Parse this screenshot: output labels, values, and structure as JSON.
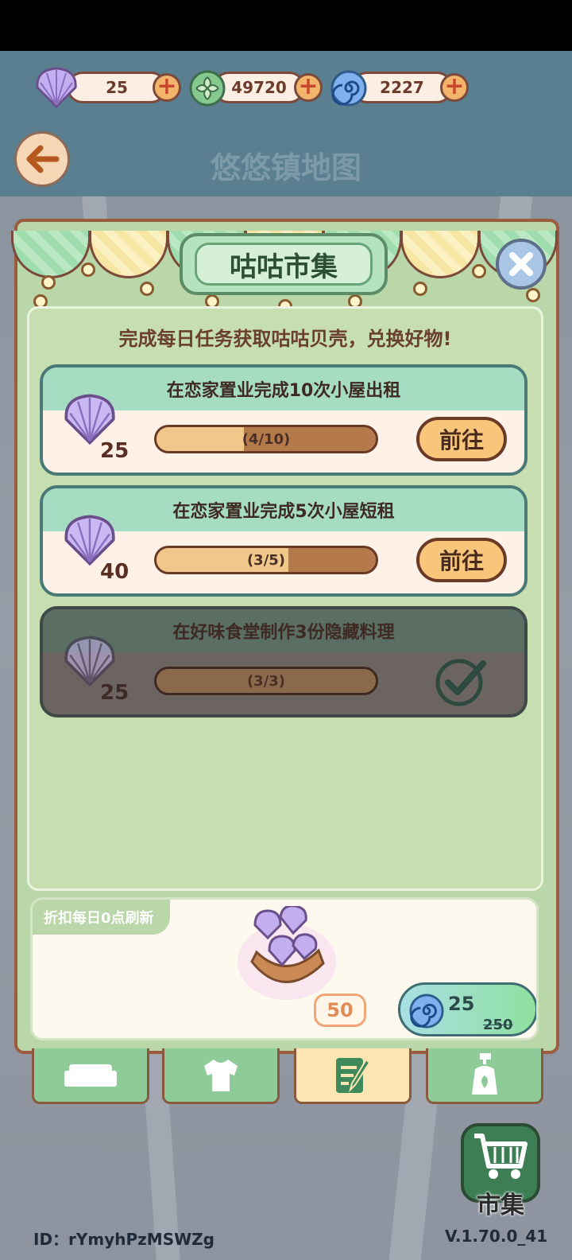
{
  "header": {
    "shells": "25",
    "leaves": "49720",
    "swirls": "2227",
    "map_title": "悠悠镇地图"
  },
  "market": {
    "title": "咕咕市集",
    "subtitle": "完成每日任务获取咕咕贝壳，兑换好物!"
  },
  "tasks": [
    {
      "title": "在恋家置业完成10次小屋出租",
      "reward": "25",
      "progress_text": "(4/10)",
      "progress": 0.4,
      "action": "前往",
      "done": false
    },
    {
      "title": "在恋家置业完成5次小屋短租",
      "reward": "40",
      "progress_text": "(3/5)",
      "progress": 0.6,
      "action": "前往",
      "done": false
    },
    {
      "title": "在好味食堂制作3份隐藏料理",
      "reward": "25",
      "progress_text": "(3/3)",
      "progress": 1.0,
      "action": "",
      "done": true
    }
  ],
  "deal": {
    "tag": "折扣每日0点刷新",
    "quantity": "50",
    "price": "25",
    "old_price": "250"
  },
  "tabs": [
    "sofa-icon",
    "shirt-icon",
    "notepad-icon",
    "bottle-icon"
  ],
  "cart": {
    "label": "市集"
  },
  "footer": {
    "id": "ID：rYmyhPzMSWZg",
    "version": "V.1.70.0_41"
  },
  "colors": {
    "accent_green": "#b9d7a8",
    "brown": "#7b4a3a",
    "teal_header": "#5a7f91"
  }
}
